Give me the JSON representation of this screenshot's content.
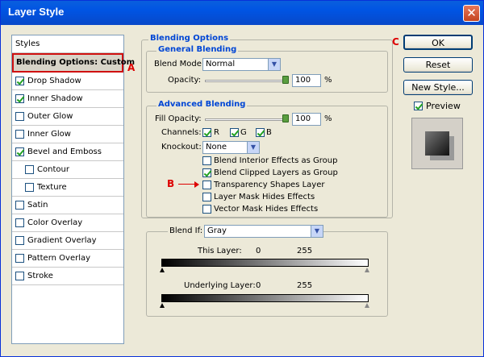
{
  "window": {
    "title": "Layer Style",
    "close_glyph": "✕"
  },
  "styles_panel": {
    "header": "Styles",
    "items": [
      {
        "label": "Blending Options: Custom",
        "selected": true
      },
      {
        "label": "Drop Shadow",
        "checked": true
      },
      {
        "label": "Inner Shadow",
        "checked": true
      },
      {
        "label": "Outer Glow",
        "checked": false
      },
      {
        "label": "Inner Glow",
        "checked": false
      },
      {
        "label": "Bevel and Emboss",
        "checked": true
      },
      {
        "label": "Contour",
        "checked": false
      },
      {
        "label": "Texture",
        "checked": false
      },
      {
        "label": "Satin",
        "checked": false
      },
      {
        "label": "Color Overlay",
        "checked": false
      },
      {
        "label": "Gradient Overlay",
        "checked": false
      },
      {
        "label": "Pattern Overlay",
        "checked": false
      },
      {
        "label": "Stroke",
        "checked": false
      }
    ]
  },
  "blending_options": {
    "title": "Blending Options",
    "general": {
      "title": "General Blending",
      "blend_mode_label": "Blend Mode:",
      "blend_mode_value": "Normal",
      "opacity_label": "Opacity:",
      "opacity_value": "100",
      "opacity_unit": "%"
    },
    "advanced": {
      "title": "Advanced Blending",
      "fill_opacity_label": "Fill Opacity:",
      "fill_opacity_value": "100",
      "fill_opacity_unit": "%",
      "channels_label": "Channels:",
      "channel_r": "R",
      "channel_g": "G",
      "channel_b": "B",
      "knockout_label": "Knockout:",
      "knockout_value": "None",
      "options": [
        {
          "label": "Blend Interior Effects as Group",
          "checked": false
        },
        {
          "label": "Blend Clipped Layers as Group",
          "checked": true
        },
        {
          "label": "Transparency Shapes Layer",
          "checked": false
        },
        {
          "label": "Layer Mask Hides Effects",
          "checked": false
        },
        {
          "label": "Vector Mask Hides Effects",
          "checked": false
        }
      ]
    },
    "blend_if": {
      "label": "Blend If:",
      "value": "Gray",
      "this_layer_label": "This Layer:",
      "this_layer_min": "0",
      "this_layer_max": "255",
      "underlying_label": "Underlying Layer:",
      "underlying_min": "0",
      "underlying_max": "255"
    }
  },
  "buttons": {
    "ok": "OK",
    "reset": "Reset",
    "new_style": "New Style..."
  },
  "preview_label": "Preview",
  "annotations": {
    "a": "A",
    "b": "B",
    "c": "C"
  },
  "colors": {
    "title_bar": "#0054e3",
    "group_title": "#0046d5",
    "annotation": "#dd0000"
  }
}
